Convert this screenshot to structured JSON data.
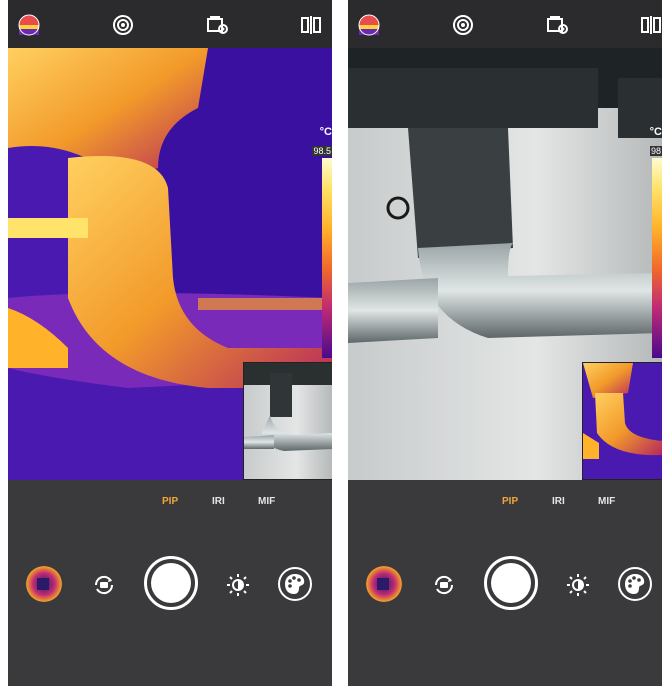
{
  "screens": [
    {
      "id": "left",
      "main_view": "thermal",
      "pip_view": "visible",
      "scale": {
        "unit": "°C",
        "max": "98.5"
      },
      "modes": [
        {
          "label": "PIP",
          "active": true
        },
        {
          "label": "IRI",
          "active": false
        },
        {
          "label": "MIF",
          "active": false
        }
      ]
    },
    {
      "id": "right",
      "main_view": "visible",
      "pip_view": "thermal",
      "scale": {
        "unit": "°C",
        "max": "98"
      },
      "modes": [
        {
          "label": "PIP",
          "active": true
        },
        {
          "label": "IRI",
          "active": false
        },
        {
          "label": "MIF",
          "active": false
        }
      ]
    }
  ],
  "icons": {
    "topbar": [
      "palette-icon",
      "target-icon",
      "settings-icon",
      "split-view-icon"
    ],
    "controls": [
      "palette-thumbnail-icon",
      "rotate-camera-icon",
      "shutter-button",
      "brightness-icon",
      "color-palette-icon"
    ]
  },
  "colors": {
    "accent": "#f0a63a",
    "panel": "#3a3a3c",
    "topbar": "#2b2b2d",
    "thermal_bg": "#4a1ab0"
  }
}
